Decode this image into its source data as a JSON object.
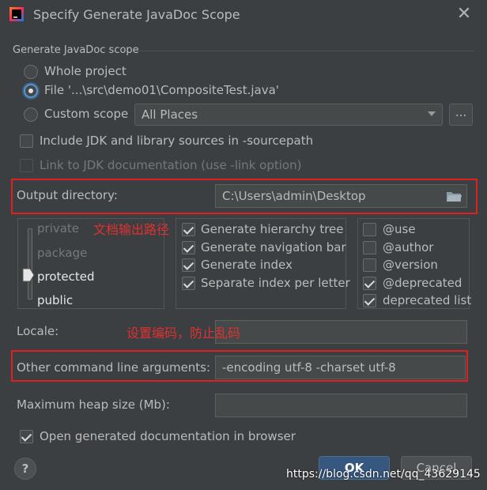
{
  "window": {
    "title": "Specify Generate JavaDoc Scope",
    "close_glyph": "✕"
  },
  "scope": {
    "section_title": "Generate JavaDoc scope",
    "whole_project": "Whole project",
    "file": "File '...\\src\\demo01\\CompositeTest.java'",
    "custom_scope": "Custom scope",
    "custom_scope_value": "All Places",
    "browse_label": "...",
    "selected": "file"
  },
  "options": {
    "include_jdk": "Include JDK and library sources in -sourcepath",
    "link_jdk": "Link to JDK documentation (use -link option)"
  },
  "output": {
    "label": "Output directory:",
    "value": "C:\\Users\\admin\\Desktop"
  },
  "visibility": {
    "levels": [
      "private",
      "package",
      "protected",
      "public"
    ],
    "selected": "protected"
  },
  "generate_options": [
    {
      "label": "Generate hierarchy tree",
      "checked": true
    },
    {
      "label": "Generate navigation bar",
      "checked": true
    },
    {
      "label": "Generate index",
      "checked": true
    },
    {
      "label": "Separate index per letter",
      "checked": true
    }
  ],
  "tag_options": [
    {
      "label": "@use",
      "checked": false
    },
    {
      "label": "@author",
      "checked": false
    },
    {
      "label": "@version",
      "checked": false
    },
    {
      "label": "@deprecated",
      "checked": true
    },
    {
      "label": "deprecated list",
      "checked": true
    }
  ],
  "annotations": {
    "output_note": "文档输出路径",
    "encoding_note": "设置编码，防止乱码"
  },
  "locale": {
    "label": "Locale:",
    "value": ""
  },
  "other_args": {
    "label": "Other command line arguments:",
    "value": "-encoding utf-8 -charset utf-8"
  },
  "heap": {
    "label": "Maximum heap size (Mb):",
    "value": ""
  },
  "open_in_browser": {
    "label": "Open generated documentation in browser",
    "checked": true
  },
  "buttons": {
    "help": "?",
    "ok": "OK",
    "cancel": "Cancel"
  },
  "watermark": "https://blog.csdn.net/qq_43629145",
  "colors": {
    "background": "#3c3f41",
    "accent": "#365880",
    "highlight_box": "#e02020"
  }
}
